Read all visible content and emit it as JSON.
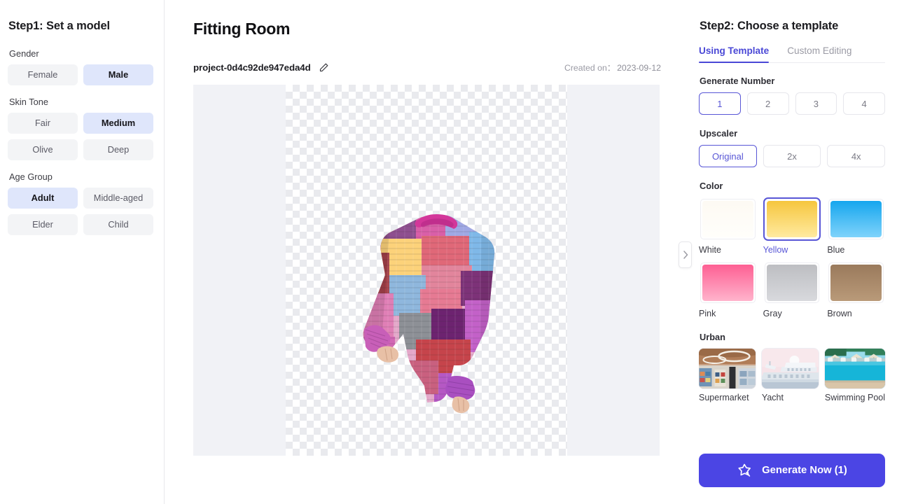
{
  "sidebar": {
    "title": "Step1: Set a model",
    "groups": [
      {
        "label": "Gender",
        "options": [
          {
            "label": "Female",
            "selected": false
          },
          {
            "label": "Male",
            "selected": true
          }
        ]
      },
      {
        "label": "Skin Tone",
        "options": [
          {
            "label": "Fair",
            "selected": false
          },
          {
            "label": "Medium",
            "selected": true
          },
          {
            "label": "Olive",
            "selected": false
          },
          {
            "label": "Deep",
            "selected": false
          }
        ]
      },
      {
        "label": "Age Group",
        "options": [
          {
            "label": "Adult",
            "selected": true
          },
          {
            "label": "Middle-aged",
            "selected": false
          },
          {
            "label": "Elder",
            "selected": false
          },
          {
            "label": "Child",
            "selected": false
          }
        ]
      }
    ]
  },
  "main": {
    "title": "Fitting Room",
    "project_name": "project-0d4c92de947eda4d",
    "edit_icon": "pencil-icon",
    "created_label": "Created on：",
    "created_date": "2023-09-12",
    "canvas_image": "patchwork-knit-sweater"
  },
  "divider": {
    "collapse_icon": "chevron-right-icon"
  },
  "panel": {
    "title": "Step2: Choose a template",
    "tabs": [
      {
        "label": "Using Template",
        "active": true
      },
      {
        "label": "Custom Editing",
        "active": false
      }
    ],
    "generate_number": {
      "label": "Generate Number",
      "options": [
        {
          "label": "1",
          "selected": true
        },
        {
          "label": "2",
          "selected": false
        },
        {
          "label": "3",
          "selected": false
        },
        {
          "label": "4",
          "selected": false
        }
      ]
    },
    "upscaler": {
      "label": "Upscaler",
      "options": [
        {
          "label": "Original",
          "selected": true
        },
        {
          "label": "2x",
          "selected": false
        },
        {
          "label": "4x",
          "selected": false
        }
      ]
    },
    "color": {
      "label": "Color",
      "options": [
        {
          "label": "White",
          "selected": false,
          "hex": "#fdfaf3",
          "hex2": "#fffefb"
        },
        {
          "label": "Yellow",
          "selected": true,
          "hex": "#f6c63e",
          "hex2": "#ffeaa0"
        },
        {
          "label": "Blue",
          "selected": false,
          "hex": "#16a6ee",
          "hex2": "#7fd3fb"
        },
        {
          "label": "Pink",
          "selected": false,
          "hex": "#fd5f93",
          "hex2": "#ffb4cc"
        },
        {
          "label": "Gray",
          "selected": false,
          "hex": "#bdbec2",
          "hex2": "#d8d9dd"
        },
        {
          "label": "Brown",
          "selected": false,
          "hex": "#9a7a5c",
          "hex2": "#b99a79"
        }
      ]
    },
    "urban": {
      "label": "Urban",
      "items": [
        {
          "label": "Supermarket",
          "image": "supermarket-interior-thumbnail"
        },
        {
          "label": "Yacht",
          "image": "yacht-deck-thumbnail"
        },
        {
          "label": "Swimming Pool",
          "image": "swimming-pool-thumbnail"
        }
      ]
    },
    "generate": {
      "label": "Generate Now (1)",
      "icon": "magic-wand-star-icon",
      "color": "#4b45e4"
    }
  },
  "theme": {
    "accent": "#4a48d6",
    "selected_chip_bg": "#dfe6fb",
    "chip_bg": "#f3f4f6"
  }
}
